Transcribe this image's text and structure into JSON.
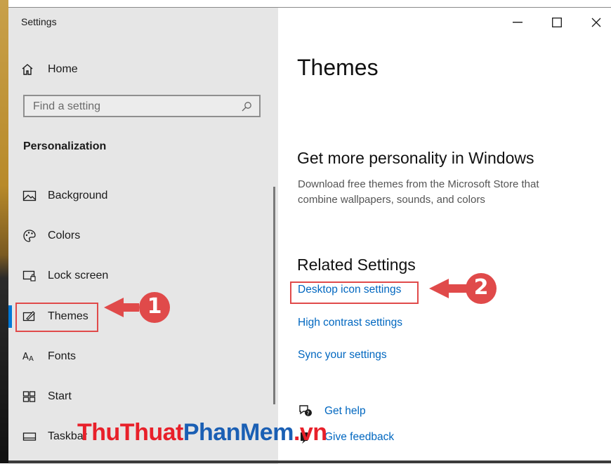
{
  "window": {
    "title": "Settings",
    "controls": {
      "minimize": "—",
      "maximize": "☐",
      "close": "✕"
    }
  },
  "sidebar": {
    "home_label": "Home",
    "search_placeholder": "Find a setting",
    "section_title": "Personalization",
    "items": [
      {
        "label": "Background",
        "icon": "image-icon"
      },
      {
        "label": "Colors",
        "icon": "palette-icon"
      },
      {
        "label": "Lock screen",
        "icon": "lock-screen-icon"
      },
      {
        "label": "Themes",
        "icon": "themes-icon",
        "selected": true
      },
      {
        "label": "Fonts",
        "icon": "fonts-icon"
      },
      {
        "label": "Start",
        "icon": "start-icon"
      },
      {
        "label": "Taskbar",
        "icon": "taskbar-icon"
      }
    ]
  },
  "main": {
    "page_title": "Themes",
    "personality_heading": "Get more personality in Windows",
    "personality_desc": "Download free themes from the Microsoft Store that combine wallpapers, sounds, and colors",
    "related_heading": "Related Settings",
    "related_links": [
      "Desktop icon settings",
      "High contrast settings",
      "Sync your settings"
    ],
    "help_links": [
      "Get help",
      "Give feedback"
    ]
  },
  "annotations": {
    "callout_1": "1",
    "callout_2": "2",
    "callout_color": "#e04a4a"
  },
  "watermark": {
    "part1": "ThuThuat",
    "part2": "PhanMem",
    "part3": ".vn"
  },
  "colors": {
    "accent": "#0067c0",
    "selected_bar": "#0078d7",
    "sidebar_bg": "#e6e6e6"
  }
}
